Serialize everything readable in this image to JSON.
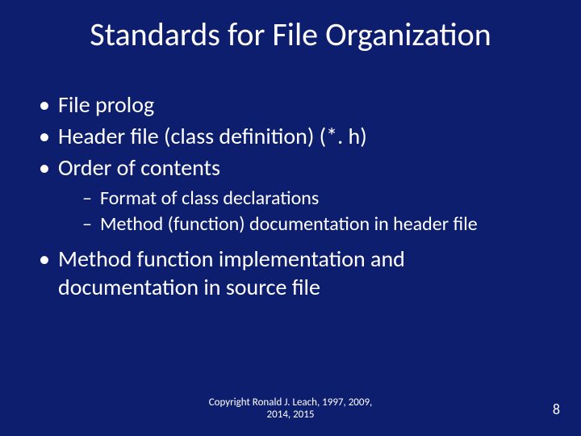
{
  "title": "Standards for File Organization",
  "bullets": {
    "b1": "File prolog",
    "b2": "Header file (class definition) (*. h)",
    "b3": "Order of contents",
    "b3_sub": {
      "s1": "Format of class declarations",
      "s2": "Method (function) documentation in header file"
    },
    "b4": "Method function implementation and documentation in source file"
  },
  "footer": {
    "line1": "Copyright Ronald J. Leach, 1997, 2009,",
    "line2": "2014, 2015"
  },
  "page_number": "8"
}
